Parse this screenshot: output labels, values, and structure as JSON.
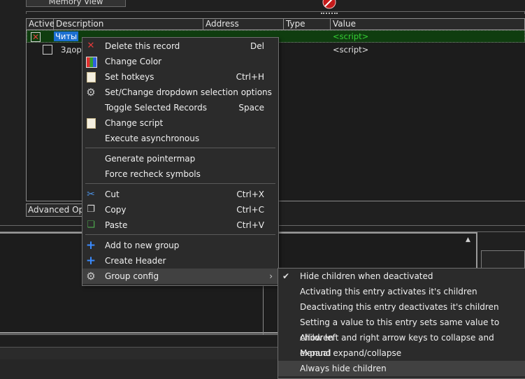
{
  "topbar": {
    "memory_view_label": "Memory View"
  },
  "table": {
    "columns": [
      "Active",
      "Description",
      "Address",
      "Type",
      "Value"
    ],
    "rows": [
      {
        "description": "Читы",
        "value": "<script>"
      },
      {
        "description": "Здор",
        "value": "<script>"
      }
    ],
    "advanced_options_label": "Advanced Opt"
  },
  "context_menu": {
    "items": [
      {
        "label": "Delete this record",
        "shortcut": "Del",
        "icon": "delete-icon"
      },
      {
        "label": "Change Color",
        "shortcut": "",
        "icon": "color-icon"
      },
      {
        "label": "Set hotkeys",
        "shortcut": "Ctrl+H",
        "icon": "hotkey-icon"
      },
      {
        "label": "Set/Change dropdown selection options",
        "shortcut": "",
        "icon": "gear-icon"
      },
      {
        "label": "Toggle Selected Records",
        "shortcut": "Space",
        "icon": ""
      },
      {
        "label": "Change script",
        "shortcut": "",
        "icon": "script-icon"
      },
      {
        "label": "Execute asynchronous",
        "shortcut": "",
        "icon": ""
      },
      {
        "label": "Generate pointermap",
        "shortcut": "",
        "icon": ""
      },
      {
        "label": "Force recheck symbols",
        "shortcut": "",
        "icon": ""
      },
      {
        "label": "Cut",
        "shortcut": "Ctrl+X",
        "icon": "cut-icon"
      },
      {
        "label": "Copy",
        "shortcut": "Ctrl+C",
        "icon": "copy-icon"
      },
      {
        "label": "Paste",
        "shortcut": "Ctrl+V",
        "icon": "paste-icon"
      },
      {
        "label": "Add to new group",
        "shortcut": "",
        "icon": "plus-icon"
      },
      {
        "label": "Create Header",
        "shortcut": "",
        "icon": "plus-icon"
      },
      {
        "label": "Group config",
        "shortcut": "",
        "icon": "gear-icon"
      }
    ]
  },
  "submenu": {
    "items": [
      {
        "label": "Hide children when deactivated",
        "checked": true
      },
      {
        "label": "Activating this entry activates it's children",
        "checked": false
      },
      {
        "label": "Deactivating this entry deactivates it's children",
        "checked": false
      },
      {
        "label": "Setting a value to this entry sets same value to children",
        "checked": false
      },
      {
        "label": "Allow left and right arrow keys to collapse and expand",
        "checked": false
      },
      {
        "label": "Manual expand/collapse",
        "checked": false
      },
      {
        "label": "Always hide children",
        "checked": false
      }
    ]
  },
  "colors": {
    "selected_row": "#0f3d0f",
    "script_value": "#35d035",
    "highlight": "#414141",
    "menu_bg": "#2b2b2b"
  }
}
